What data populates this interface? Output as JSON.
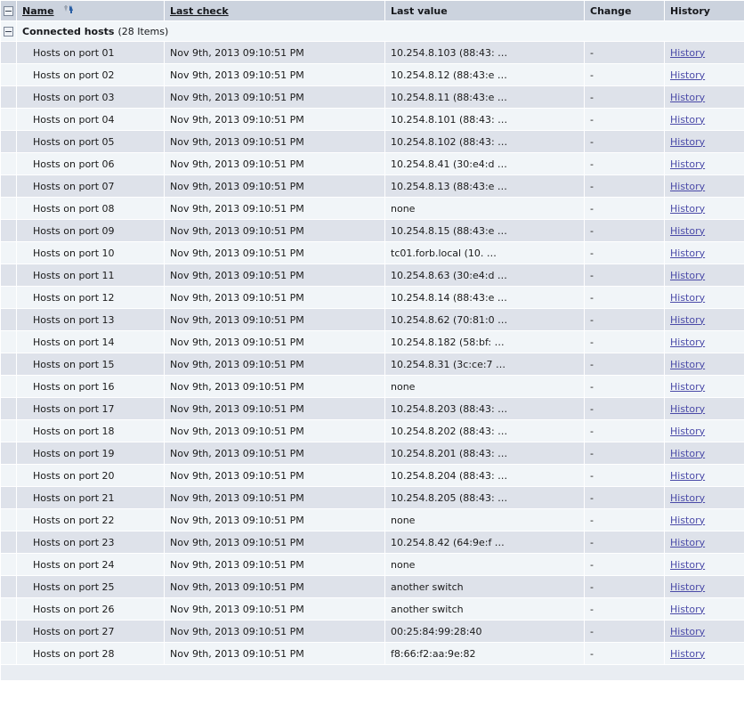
{
  "table": {
    "columns": [
      {
        "key": "select",
        "label": "",
        "sortable": false,
        "name": "column-select"
      },
      {
        "key": "name",
        "label": "Name",
        "sortable": true,
        "name": "column-name",
        "sort": "asc"
      },
      {
        "key": "check",
        "label": "Last check",
        "sortable": true,
        "name": "column-last-check"
      },
      {
        "key": "value",
        "label": "Last value",
        "sortable": false,
        "name": "column-last-value"
      },
      {
        "key": "change",
        "label": "Change",
        "sortable": false,
        "name": "column-change"
      },
      {
        "key": "history",
        "label": "History",
        "sortable": false,
        "name": "column-history"
      }
    ],
    "group": {
      "title": "Connected hosts",
      "count_label": "(28 Items)",
      "collapse_icon": "minus-box-icon",
      "expanded": true
    },
    "history_link_label": "History",
    "no_change_value": "-",
    "rows": [
      {
        "name": "Hosts on port 01",
        "check": "Nov 9th, 2013 09:10:51 PM",
        "value": "10.254.8.103 (88:43: …",
        "change": "-",
        "history": "History"
      },
      {
        "name": "Hosts on port 02",
        "check": "Nov 9th, 2013 09:10:51 PM",
        "value": "10.254.8.12 (88:43:e …",
        "change": "-",
        "history": "History"
      },
      {
        "name": "Hosts on port 03",
        "check": "Nov 9th, 2013 09:10:51 PM",
        "value": "10.254.8.11 (88:43:e …",
        "change": "-",
        "history": "History"
      },
      {
        "name": "Hosts on port 04",
        "check": "Nov 9th, 2013 09:10:51 PM",
        "value": "10.254.8.101 (88:43: …",
        "change": "-",
        "history": "History"
      },
      {
        "name": "Hosts on port 05",
        "check": "Nov 9th, 2013 09:10:51 PM",
        "value": "10.254.8.102 (88:43: …",
        "change": "-",
        "history": "History"
      },
      {
        "name": "Hosts on port 06",
        "check": "Nov 9th, 2013 09:10:51 PM",
        "value": "10.254.8.41 (30:e4:d …",
        "change": "-",
        "history": "History"
      },
      {
        "name": "Hosts on port 07",
        "check": "Nov 9th, 2013 09:10:51 PM",
        "value": "10.254.8.13 (88:43:e …",
        "change": "-",
        "history": "History"
      },
      {
        "name": "Hosts on port 08",
        "check": "Nov 9th, 2013 09:10:51 PM",
        "value": "none",
        "change": "-",
        "history": "History"
      },
      {
        "name": "Hosts on port 09",
        "check": "Nov 9th, 2013 09:10:51 PM",
        "value": "10.254.8.15 (88:43:e …",
        "change": "-",
        "history": "History"
      },
      {
        "name": "Hosts on port 10",
        "check": "Nov 9th, 2013 09:10:51 PM",
        "value": "tc01.forb.local (10. …",
        "change": "-",
        "history": "History"
      },
      {
        "name": "Hosts on port 11",
        "check": "Nov 9th, 2013 09:10:51 PM",
        "value": "10.254.8.63 (30:e4:d …",
        "change": "-",
        "history": "History"
      },
      {
        "name": "Hosts on port 12",
        "check": "Nov 9th, 2013 09:10:51 PM",
        "value": "10.254.8.14 (88:43:e …",
        "change": "-",
        "history": "History"
      },
      {
        "name": "Hosts on port 13",
        "check": "Nov 9th, 2013 09:10:51 PM",
        "value": "10.254.8.62 (70:81:0 …",
        "change": "-",
        "history": "History"
      },
      {
        "name": "Hosts on port 14",
        "check": "Nov 9th, 2013 09:10:51 PM",
        "value": "10.254.8.182 (58:bf: …",
        "change": "-",
        "history": "History"
      },
      {
        "name": "Hosts on port 15",
        "check": "Nov 9th, 2013 09:10:51 PM",
        "value": "10.254.8.31 (3c:ce:7 …",
        "change": "-",
        "history": "History"
      },
      {
        "name": "Hosts on port 16",
        "check": "Nov 9th, 2013 09:10:51 PM",
        "value": "none",
        "change": "-",
        "history": "History"
      },
      {
        "name": "Hosts on port 17",
        "check": "Nov 9th, 2013 09:10:51 PM",
        "value": "10.254.8.203 (88:43: …",
        "change": "-",
        "history": "History"
      },
      {
        "name": "Hosts on port 18",
        "check": "Nov 9th, 2013 09:10:51 PM",
        "value": "10.254.8.202 (88:43: …",
        "change": "-",
        "history": "History"
      },
      {
        "name": "Hosts on port 19",
        "check": "Nov 9th, 2013 09:10:51 PM",
        "value": "10.254.8.201 (88:43: …",
        "change": "-",
        "history": "History"
      },
      {
        "name": "Hosts on port 20",
        "check": "Nov 9th, 2013 09:10:51 PM",
        "value": "10.254.8.204 (88:43: …",
        "change": "-",
        "history": "History"
      },
      {
        "name": "Hosts on port 21",
        "check": "Nov 9th, 2013 09:10:51 PM",
        "value": "10.254.8.205 (88:43: …",
        "change": "-",
        "history": "History"
      },
      {
        "name": "Hosts on port 22",
        "check": "Nov 9th, 2013 09:10:51 PM",
        "value": "none",
        "change": "-",
        "history": "History"
      },
      {
        "name": "Hosts on port 23",
        "check": "Nov 9th, 2013 09:10:51 PM",
        "value": "10.254.8.42 (64:9e:f …",
        "change": "-",
        "history": "History"
      },
      {
        "name": "Hosts on port 24",
        "check": "Nov 9th, 2013 09:10:51 PM",
        "value": "none",
        "change": "-",
        "history": "History"
      },
      {
        "name": "Hosts on port 25",
        "check": "Nov 9th, 2013 09:10:51 PM",
        "value": "another switch",
        "change": "-",
        "history": "History"
      },
      {
        "name": "Hosts on port 26",
        "check": "Nov 9th, 2013 09:10:51 PM",
        "value": "another switch",
        "change": "-",
        "history": "History"
      },
      {
        "name": "Hosts on port 27",
        "check": "Nov 9th, 2013 09:10:51 PM",
        "value": "00:25:84:99:28:40",
        "change": "-",
        "history": "History"
      },
      {
        "name": "Hosts on port 28",
        "check": "Nov 9th, 2013 09:10:51 PM",
        "value": "f8:66:f2:aa:9e:82",
        "change": "-",
        "history": "History"
      }
    ]
  },
  "colors": {
    "header_bg": "#ccd3de",
    "row_odd_bg": "#dee2ea",
    "row_even_bg": "#f1f5f8",
    "group_bg": "#f2f6f9",
    "footer_bg": "#e9edf2",
    "link": "#4a4aa8",
    "sort_arrow_active": "#2a5fa5",
    "sort_arrow_inactive": "#9aa3b0"
  }
}
